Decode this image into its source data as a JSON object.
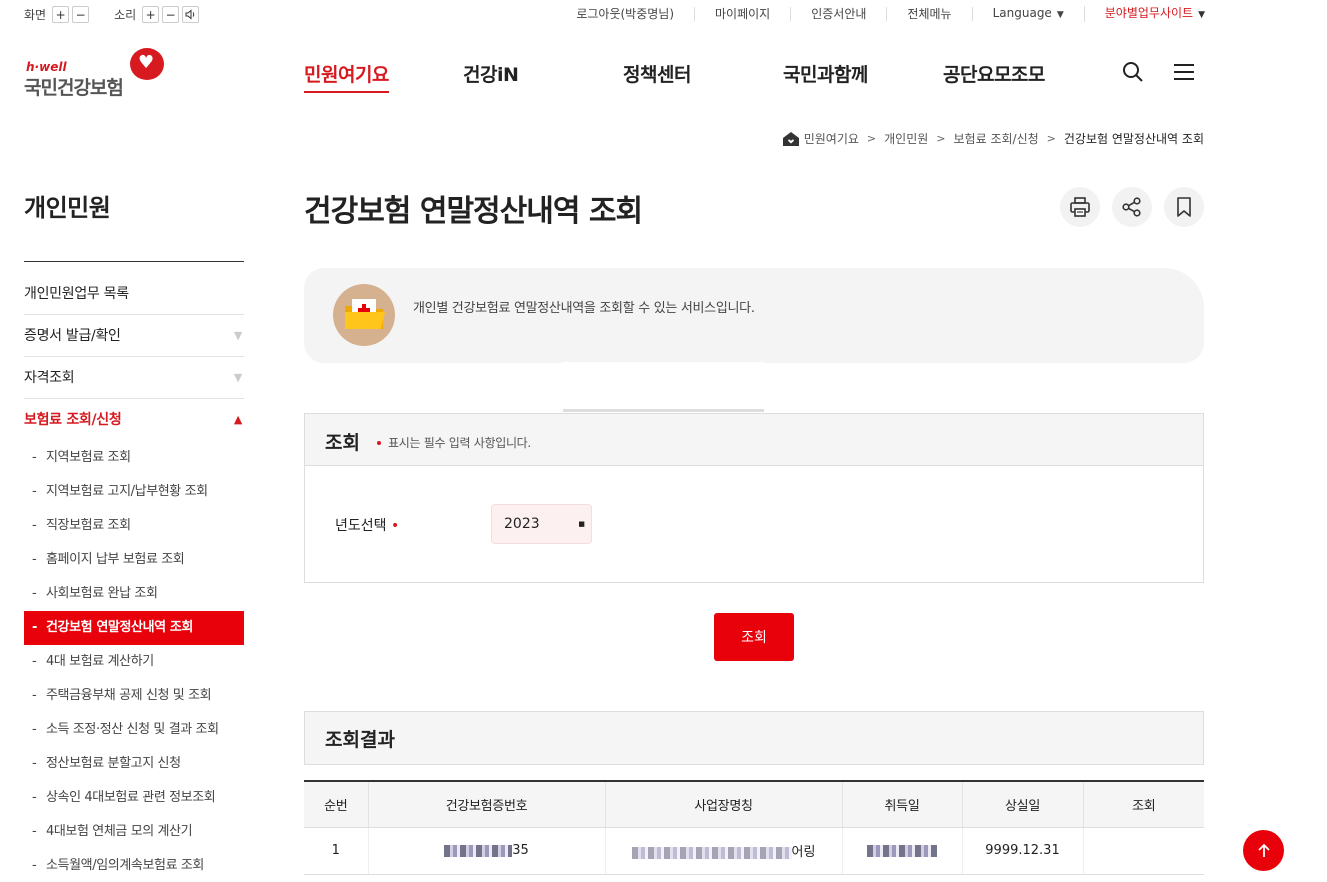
{
  "utility": {
    "screen_label": "화면",
    "sound_label": "소리",
    "plus": "+",
    "minus": "−",
    "links": [
      "로그아웃(박중명님)",
      "마이페이지",
      "인증서안내",
      "전체메뉴"
    ],
    "language": "Language",
    "site_link": "분야별업무사이트"
  },
  "logo": {
    "tag": "h·well",
    "name": "국민건강보험"
  },
  "gnb": [
    "민원여기요",
    "건강iN",
    "정책센터",
    "국민과함께",
    "공단요모조모"
  ],
  "breadcrumb": [
    "민원여기요",
    "개인민원",
    "보험료 조회/신청",
    "건강보험 연말정산내역 조회"
  ],
  "sidebar": {
    "title": "개인민원",
    "level1": [
      "개인민원업무 목록",
      "증명서 발급/확인",
      "자격조회",
      "보험료 조회/신청"
    ],
    "level2": [
      "지역보험료 조회",
      "지역보험료 고지/납부현황 조회",
      "직장보험료 조회",
      "홈페이지 납부 보험료 조회",
      "사회보험료 완납 조회",
      "건강보험 연말정산내역 조회",
      "4대 보험료 계산하기",
      "주택금융부채 공제 신청 및 조회",
      "소득 조정·정산 신청 및 결과 조회",
      "정산보험료 분할고지 신청",
      "상속인 4대보험료 관련 정보조회",
      "4대보험 연체금 모의 계산기",
      "소득월액/임의계속보험료 조회"
    ]
  },
  "page": {
    "title": "건강보험 연말정산내역 조회",
    "intro": "개인별 건강보험료 연말정산내역을 조회할 수 있는 서비스입니다."
  },
  "search": {
    "title": "조회",
    "note": "표시는 필수 입력 사항입니다.",
    "year_label": "년도선택",
    "year_value": "2023",
    "button": "조회"
  },
  "result": {
    "title": "조회결과",
    "columns": [
      "순번",
      "건강보험증번호",
      "사업장명칭",
      "취득일",
      "상실일",
      "조회"
    ],
    "rows": [
      {
        "no": "1",
        "card_suffix": "35",
        "company_suffix": "어링",
        "lost": "9999.12.31"
      }
    ]
  },
  "colors": {
    "accent": "#e8000b",
    "brand_red": "#d71920"
  }
}
